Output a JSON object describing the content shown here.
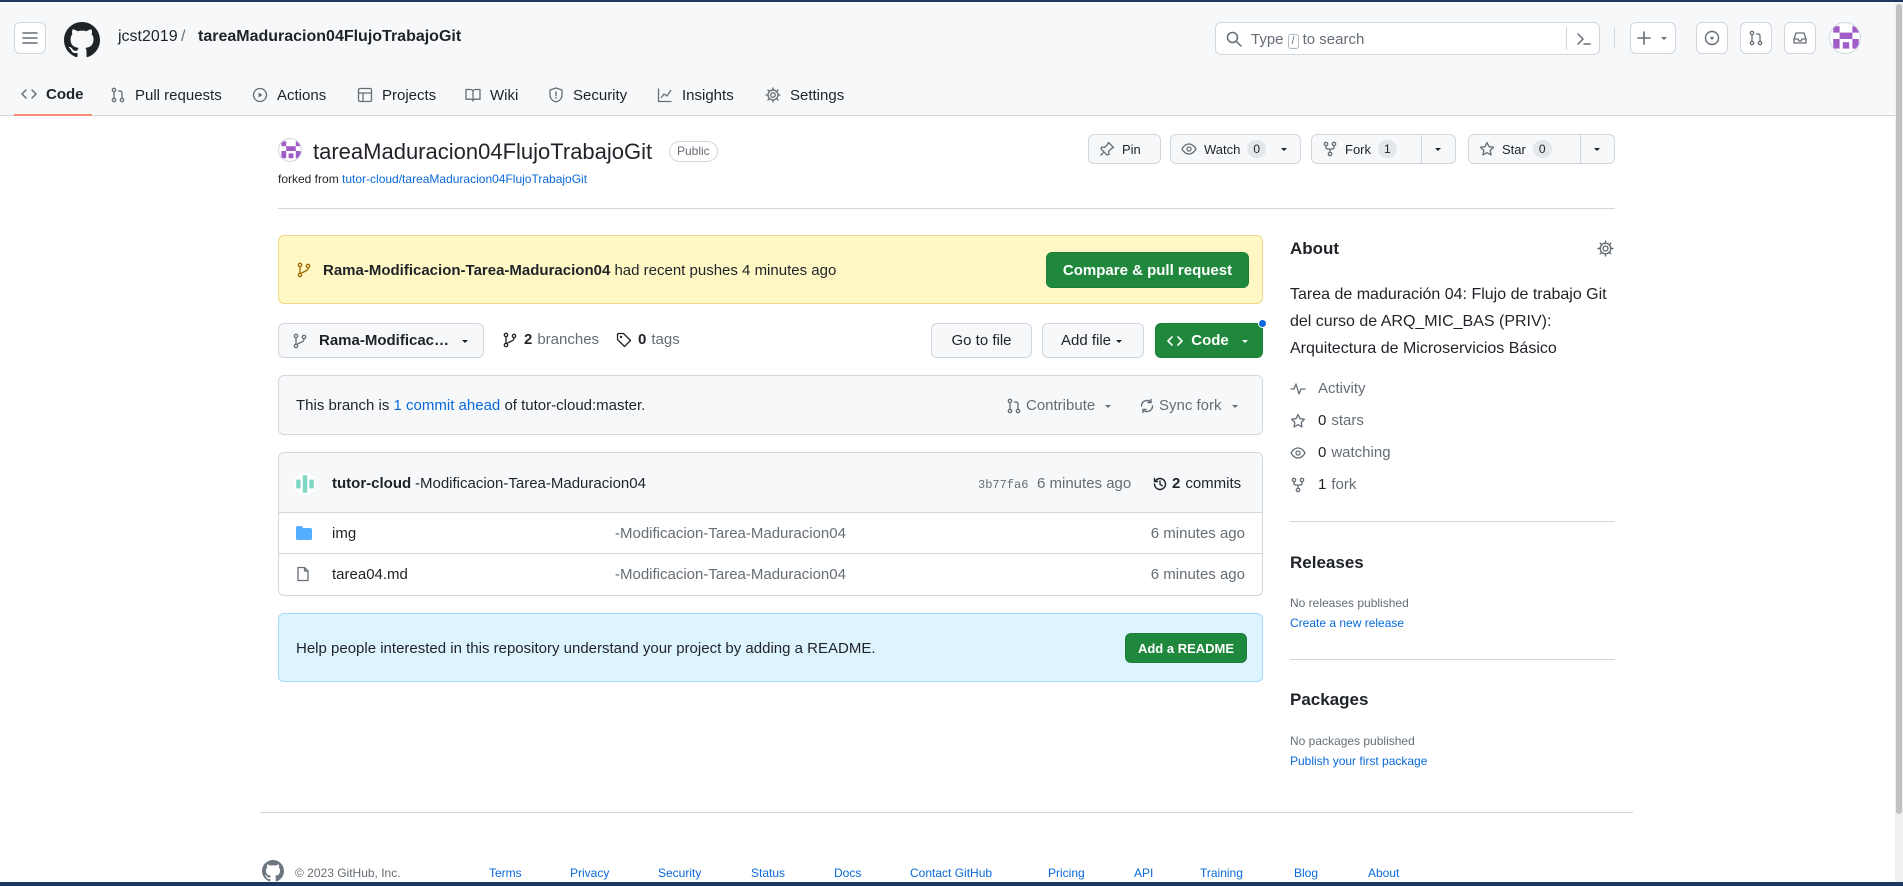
{
  "header": {
    "owner": "jcst2019",
    "separator": "/",
    "repo": "tareaMaduracion04FlujoTrabajoGit",
    "search_prefix": "Type",
    "search_key": "/",
    "search_suffix": "to search"
  },
  "tabs": [
    {
      "label": "Code",
      "icon": "code-icon"
    },
    {
      "label": "Pull requests",
      "icon": "pull-request-icon"
    },
    {
      "label": "Actions",
      "icon": "play-icon"
    },
    {
      "label": "Projects",
      "icon": "table-icon"
    },
    {
      "label": "Wiki",
      "icon": "book-icon"
    },
    {
      "label": "Security",
      "icon": "shield-icon"
    },
    {
      "label": "Insights",
      "icon": "graph-icon"
    },
    {
      "label": "Settings",
      "icon": "gear-icon"
    }
  ],
  "repo": {
    "name": "tareaMaduracion04FlujoTrabajoGit",
    "visibility": "Public",
    "forked_prefix": "forked from",
    "forked_from": "tutor-cloud/tareaMaduracion04FlujoTrabajoGit"
  },
  "actions": {
    "pin": "Pin",
    "watch": "Watch",
    "watch_count": "0",
    "fork": "Fork",
    "fork_count": "1",
    "star": "Star",
    "star_count": "0"
  },
  "banner": {
    "branch": "Rama-Modificacion-Tarea-Maduracion04",
    "text": "had recent pushes 4 minutes ago",
    "button": "Compare & pull request"
  },
  "toolbar": {
    "branch": "Rama-Modificac…",
    "branches_count": "2",
    "branches_label": "branches",
    "tags_count": "0",
    "tags_label": "tags",
    "go_to_file": "Go to file",
    "add_file": "Add file",
    "code": "Code"
  },
  "ahead": {
    "prefix": "This branch is",
    "link": "1 commit ahead",
    "suffix": "of tutor-cloud:master.",
    "contribute": "Contribute",
    "sync": "Sync fork"
  },
  "commit": {
    "author": "tutor-cloud",
    "message": "-Modificacion-Tarea-Maduracion04",
    "sha": "3b77fa6",
    "ago": "6 minutes ago",
    "commits_count": "2",
    "commits_label": "commits"
  },
  "files": [
    {
      "name": "img",
      "type": "folder",
      "message": "-Modificacion-Tarea-Maduracion04",
      "age": "6 minutes ago"
    },
    {
      "name": "tarea04.md",
      "type": "file",
      "message": "-Modificacion-Tarea-Maduracion04",
      "age": "6 minutes ago"
    }
  ],
  "readme": {
    "text": "Help people interested in this repository understand your project by adding a README.",
    "button": "Add a README"
  },
  "about": {
    "title": "About",
    "description": "Tarea de maduración 04: Flujo de trabajo Git del curso de ARQ_MIC_BAS (PRIV): Arquitectura de Microservicios Básico",
    "activity": "Activity",
    "stars_count": "0",
    "stars_label": "stars",
    "watching_count": "0",
    "watching_label": "watching",
    "forks_count": "1",
    "forks_label": "fork"
  },
  "releases": {
    "title": "Releases",
    "empty": "No releases published",
    "link": "Create a new release"
  },
  "packages": {
    "title": "Packages",
    "empty": "No packages published",
    "link": "Publish your first package"
  },
  "footer": {
    "copyright": "© 2023 GitHub, Inc.",
    "links": [
      "Terms",
      "Privacy",
      "Security",
      "Status",
      "Docs",
      "Contact GitHub",
      "Pricing",
      "API",
      "Training",
      "Blog",
      "About"
    ]
  },
  "colors": {
    "green": "#1f883d",
    "link": "#0969da",
    "banner_bg": "#fff8c5",
    "readme_bg": "#ddf4ff",
    "active_tab": "#fd8c73"
  }
}
